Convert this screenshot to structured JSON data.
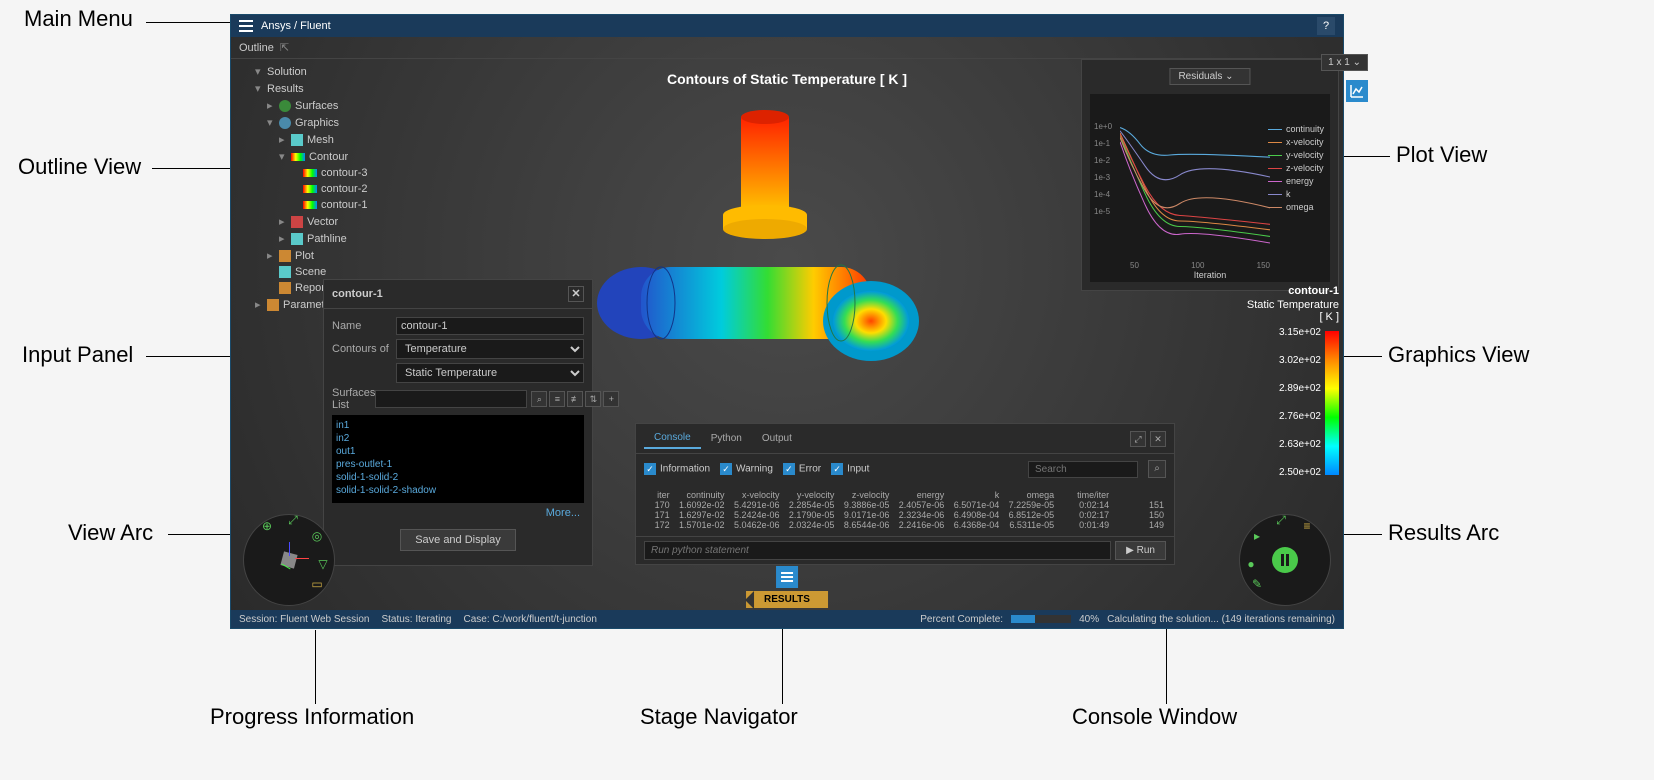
{
  "titlebar": {
    "brand": "Ansys / Fluent"
  },
  "callouts": {
    "main_menu": "Main Menu",
    "outline_view": "Outline View",
    "input_panel": "Input Panel",
    "view_arc": "View Arc",
    "progress_info": "Progress Information",
    "stage_nav": "Stage Navigator",
    "console_window": "Console Window",
    "plot_view": "Plot View",
    "graphics_view": "Graphics View",
    "results_arc": "Results Arc"
  },
  "outline": {
    "header": "Outline",
    "items": [
      {
        "label": "Solution",
        "level": 1,
        "caret": "▾"
      },
      {
        "label": "Results",
        "level": 1,
        "caret": "▾"
      },
      {
        "label": "Surfaces",
        "level": 2,
        "caret": "▸",
        "icon": "icon-green"
      },
      {
        "label": "Graphics",
        "level": 2,
        "caret": "▾",
        "icon": "icon-blue"
      },
      {
        "label": "Mesh",
        "level": 3,
        "caret": "▸",
        "icon": "icon-cyan"
      },
      {
        "label": "Contour",
        "level": 3,
        "caret": "▾",
        "icon": "contour-swatch"
      },
      {
        "label": "contour-3",
        "level": 4,
        "icon": "contour-swatch"
      },
      {
        "label": "contour-2",
        "level": 4,
        "icon": "contour-swatch"
      },
      {
        "label": "contour-1",
        "level": 4,
        "icon": "contour-swatch"
      },
      {
        "label": "Vector",
        "level": 3,
        "caret": "▸",
        "icon": "icon-red"
      },
      {
        "label": "Pathline",
        "level": 3,
        "caret": "▸",
        "icon": "icon-cyan"
      },
      {
        "label": "Plot",
        "level": 2,
        "caret": "▸",
        "icon": "icon-orange"
      },
      {
        "label": "Scene",
        "level": 2,
        "icon": "icon-cyan"
      },
      {
        "label": "Report",
        "level": 2,
        "icon": "icon-orange"
      },
      {
        "label": "Parameters",
        "level": 1,
        "caret": "▸",
        "icon": "icon-orange"
      }
    ]
  },
  "graphics": {
    "title": "Contours of Static Temperature  [ K ]"
  },
  "input_panel": {
    "title": "contour-1",
    "fields": {
      "name_label": "Name",
      "name_value": "contour-1",
      "contours_of_label": "Contours of",
      "contours_of_value": "Temperature",
      "sub_value": "Static Temperature",
      "surfaces_label": "Surfaces List"
    },
    "surfaces": [
      "in1",
      "in2",
      "out1",
      "pres-outlet-1",
      "solid-1-solid-2",
      "solid-1-solid-2-shadow"
    ],
    "more": "More...",
    "save_btn": "Save and Display"
  },
  "plot": {
    "grid_label": "1 x 1",
    "dropdown": "Residuals",
    "legend": [
      {
        "name": "continuity",
        "color": "#5aaadd"
      },
      {
        "name": "x-velocity",
        "color": "#dd8844"
      },
      {
        "name": "y-velocity",
        "color": "#4aca4a"
      },
      {
        "name": "z-velocity",
        "color": "#dd4444"
      },
      {
        "name": "energy",
        "color": "#cc66cc"
      },
      {
        "name": "k",
        "color": "#8888cc"
      },
      {
        "name": "omega",
        "color": "#cc8866"
      }
    ],
    "y_ticks": [
      "1e+0",
      "1e-1",
      "1e-2",
      "1e-3",
      "1e-4",
      "1e-5"
    ],
    "x_ticks": [
      "50",
      "100",
      "150"
    ],
    "xlabel": "Iteration"
  },
  "chart_data": {
    "type": "line",
    "title": "Residuals",
    "xlabel": "Iteration",
    "ylabel": "",
    "yscale": "log",
    "xlim": [
      0,
      172
    ],
    "ylim": [
      1e-06,
      1
    ],
    "x_ticks": [
      50,
      100,
      150
    ],
    "y_ticks": [
      1,
      0.1,
      0.01,
      0.001,
      0.0001,
      1e-05
    ],
    "x": [
      0,
      10,
      20,
      30,
      50,
      80,
      120,
      172
    ],
    "series": [
      {
        "name": "continuity",
        "color": "#5aaadd",
        "values": [
          1.0,
          0.5,
          0.3,
          0.08,
          0.03,
          0.02,
          0.017,
          0.016
        ]
      },
      {
        "name": "x-velocity",
        "color": "#dd8844",
        "values": [
          0.5,
          0.08,
          0.01,
          0.001,
          0.0001,
          3e-05,
          1e-05,
          5e-06
        ]
      },
      {
        "name": "y-velocity",
        "color": "#4aca4a",
        "values": [
          0.5,
          0.07,
          0.008,
          0.0008,
          8e-05,
          2e-05,
          5e-06,
          2e-06
        ]
      },
      {
        "name": "z-velocity",
        "color": "#dd4444",
        "values": [
          0.5,
          0.09,
          0.012,
          0.0012,
          0.00012,
          4e-05,
          1.5e-05,
          8e-06
        ]
      },
      {
        "name": "energy",
        "color": "#cc66cc",
        "values": [
          0.3,
          0.03,
          0.003,
          0.0003,
          3e-05,
          8e-06,
          3e-06,
          2e-06
        ]
      },
      {
        "name": "k",
        "color": "#8888cc",
        "values": [
          0.8,
          0.2,
          0.03,
          0.003,
          0.001,
          0.0008,
          0.0007,
          0.00065
        ]
      },
      {
        "name": "omega",
        "color": "#cc8866",
        "values": [
          0.6,
          0.1,
          0.01,
          0.001,
          0.0003,
          0.0001,
          8e-05,
          6.5e-05
        ]
      }
    ]
  },
  "colorbar": {
    "name": "contour-1",
    "quantity": "Static Temperature",
    "unit": "[ K ]",
    "labels": [
      "3.15e+02",
      "3.02e+02",
      "2.89e+02",
      "2.76e+02",
      "2.63e+02",
      "2.50e+02"
    ]
  },
  "console": {
    "tabs": [
      "Console",
      "Python",
      "Output"
    ],
    "filters": {
      "info": "Information",
      "warn": "Warning",
      "err": "Error",
      "input": "Input"
    },
    "search_placeholder": "Search",
    "headers": [
      "iter",
      "continuity",
      "x-velocity",
      "y-velocity",
      "z-velocity",
      "energy",
      "k",
      "omega",
      "time/iter",
      ""
    ],
    "rows": [
      [
        "170",
        "1.6092e-02",
        "5.4291e-06",
        "2.2854e-05",
        "9.3886e-05",
        "2.4057e-06",
        "6.5071e-04",
        "7.2259e-05",
        "0:02:14",
        "151"
      ],
      [
        "171",
        "1.6297e-02",
        "5.2424e-06",
        "2.1790e-05",
        "9.0171e-06",
        "2.3234e-06",
        "6.4908e-04",
        "6.8512e-05",
        "0:02:17",
        "150"
      ],
      [
        "172",
        "1.5701e-02",
        "5.0462e-06",
        "2.0324e-05",
        "8.6544e-06",
        "2.2416e-06",
        "6.4368e-04",
        "6.5311e-05",
        "0:01:49",
        "149"
      ]
    ],
    "input_placeholder": "Run python statement",
    "run_btn": "▶ Run"
  },
  "stage": {
    "label": "RESULTS"
  },
  "statusbar": {
    "session": "Session: Fluent Web Session",
    "status": "Status: Iterating",
    "case": "Case: C:/work/fluent/t-junction",
    "percent_label": "Percent Complete:",
    "percent": "40%",
    "calc": "Calculating the solution... (149 iterations remaining)"
  }
}
